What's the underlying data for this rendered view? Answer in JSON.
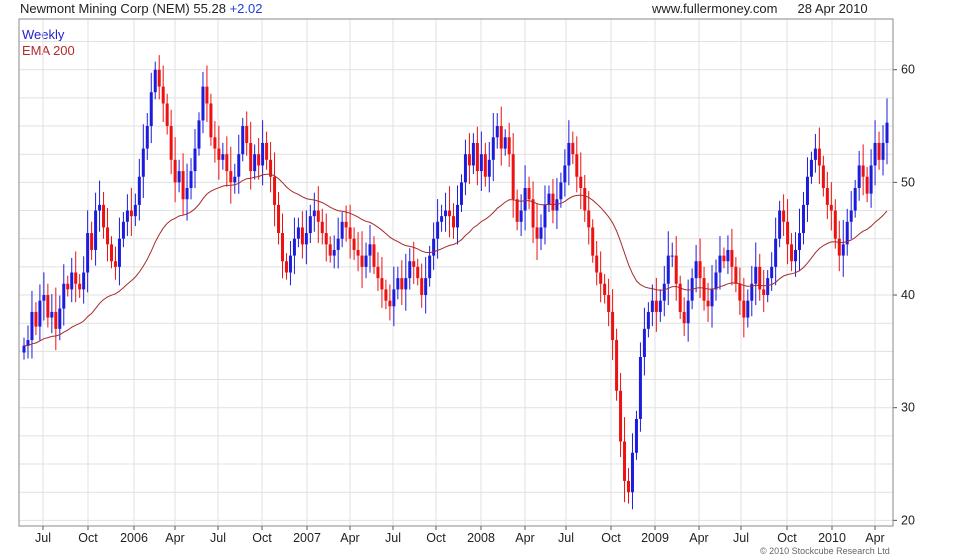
{
  "header": {
    "title": "Newmont Mining Corp (NEM)",
    "last": "55.28",
    "change": "+2.02",
    "site": "www.fullermoney.com",
    "date": "28 Apr 2010"
  },
  "legend": {
    "period": "Weekly",
    "ema": "EMA 200"
  },
  "copyright": "© 2010 Stockcube Research Ltd",
  "chart_data": {
    "type": "candlestick",
    "ylim": [
      19.5,
      64.5
    ],
    "yticks": [
      20,
      30,
      40,
      50,
      60
    ],
    "xticks": [
      "Jul",
      "Oct",
      "2006",
      "Apr",
      "Jul",
      "Oct",
      "2007",
      "Apr",
      "Jul",
      "Oct",
      "2008",
      "Apr",
      "Jul",
      "Oct",
      "2009",
      "Apr",
      "Jul",
      "Oct",
      "2010",
      "Apr"
    ],
    "grid": true,
    "colors": {
      "up": "#1c1cdf",
      "down": "#ee1111",
      "ema": "#a52a2a",
      "grid": "#e1e1e1"
    },
    "series": [
      {
        "name": "Weekly",
        "close": [
          35.5,
          36.0,
          38.5,
          37.2,
          39.5,
          40.0,
          38.0,
          38.5,
          37.0,
          38.8,
          41.0,
          40.5,
          42.0,
          41.0,
          40.5,
          42.0,
          45.5,
          44.0,
          47.5,
          48.0,
          46.0,
          44.5,
          43.0,
          42.5,
          45.0,
          46.5,
          47.5,
          47.0,
          48.0,
          50.5,
          53.0,
          55.0,
          58.0,
          60.0,
          58.5,
          57.0,
          55.0,
          52.0,
          50.0,
          51.0,
          48.5,
          49.5,
          51.0,
          53.0,
          55.5,
          58.5,
          57.0,
          54.0,
          53.0,
          52.0,
          52.5,
          51.0,
          50.0,
          50.5,
          52.5,
          55.0,
          53.5,
          51.0,
          52.5,
          51.5,
          53.5,
          52.0,
          50.5,
          48.0,
          45.5,
          43.0,
          42.0,
          43.5,
          45.0,
          46.0,
          44.5,
          45.5,
          47.0,
          47.5,
          46.5,
          45.5,
          44.5,
          43.5,
          44.0,
          45.0,
          46.5,
          46.0,
          45.0,
          44.0,
          43.5,
          42.5,
          43.5,
          44.5,
          42.5,
          41.5,
          40.5,
          39.5,
          39.0,
          40.5,
          41.5,
          40.5,
          41.5,
          43.0,
          42.5,
          41.5,
          40.0,
          41.5,
          43.5,
          45.0,
          46.5,
          47.0,
          47.5,
          47.0,
          46.0,
          48.0,
          50.0,
          52.5,
          51.5,
          53.5,
          51.0,
          52.5,
          50.5,
          52.0,
          54.0,
          55.0,
          53.0,
          54.0,
          52.5,
          48.5,
          46.5,
          47.5,
          49.5,
          48.5,
          46.0,
          45.0,
          46.0,
          48.0,
          49.0,
          47.5,
          48.5,
          50.0,
          51.5,
          53.5,
          52.5,
          50.5,
          49.5,
          47.5,
          46.0,
          43.5,
          42.0,
          41.0,
          40.0,
          38.5,
          36.0,
          31.5,
          27.0,
          23.5,
          22.5,
          26.0,
          29.0,
          34.5,
          37.0,
          38.5,
          39.5,
          38.5,
          39.5,
          41.0,
          43.5,
          43.5,
          41.0,
          38.5,
          37.5,
          39.5,
          41.5,
          43.0,
          41.5,
          39.5,
          39.0,
          40.5,
          42.0,
          43.5,
          43.0,
          44.0,
          42.5,
          41.0,
          39.5,
          38.0,
          39.5,
          41.0,
          42.5,
          40.5,
          40.0,
          41.5,
          42.5,
          45.0,
          47.5,
          46.5,
          44.5,
          43.0,
          44.0,
          45.5,
          48.0,
          50.5,
          52.0,
          53.0,
          51.5,
          49.5,
          48.0,
          47.5,
          45.0,
          43.5,
          44.5,
          46.5,
          47.5,
          49.5,
          51.5,
          50.5,
          49.0,
          51.5,
          53.5,
          52.0,
          53.5,
          55.3
        ]
      }
    ]
  }
}
